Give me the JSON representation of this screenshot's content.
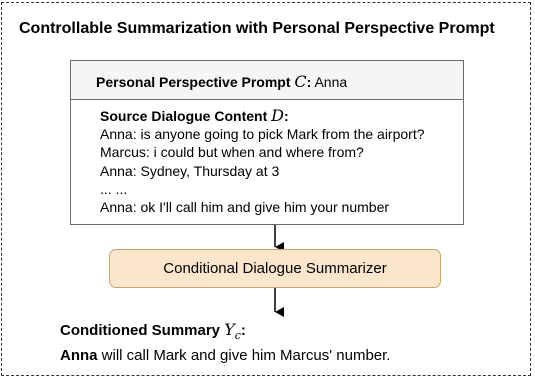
{
  "diagram": {
    "title": "Controllable Summarization with Personal Perspective Prompt",
    "prompt": {
      "label": "Personal Perspective Prompt",
      "symbol": "C",
      "value": "Anna"
    },
    "source": {
      "label": "Source Dialogue Content",
      "symbol": "D",
      "lines": [
        "Anna: is anyone going to pick Mark from the airport?",
        "Marcus: i could but when and where from?",
        "Anna: Sydney, Thursday at 3",
        "... ...",
        "Anna: ok I'll call him and give him your number"
      ]
    },
    "model": {
      "label": "Conditional Dialogue Summarizer"
    },
    "summary": {
      "label": "Conditioned Summary",
      "symbol": "Y",
      "subscript": "c",
      "speaker": "Anna",
      "rest": " will call Mark and give him Marcus' number."
    }
  },
  "colors": {
    "model_fill": "#fbe6cc",
    "model_border": "#c9a36a",
    "prompt_fill": "#f5f5f5"
  }
}
